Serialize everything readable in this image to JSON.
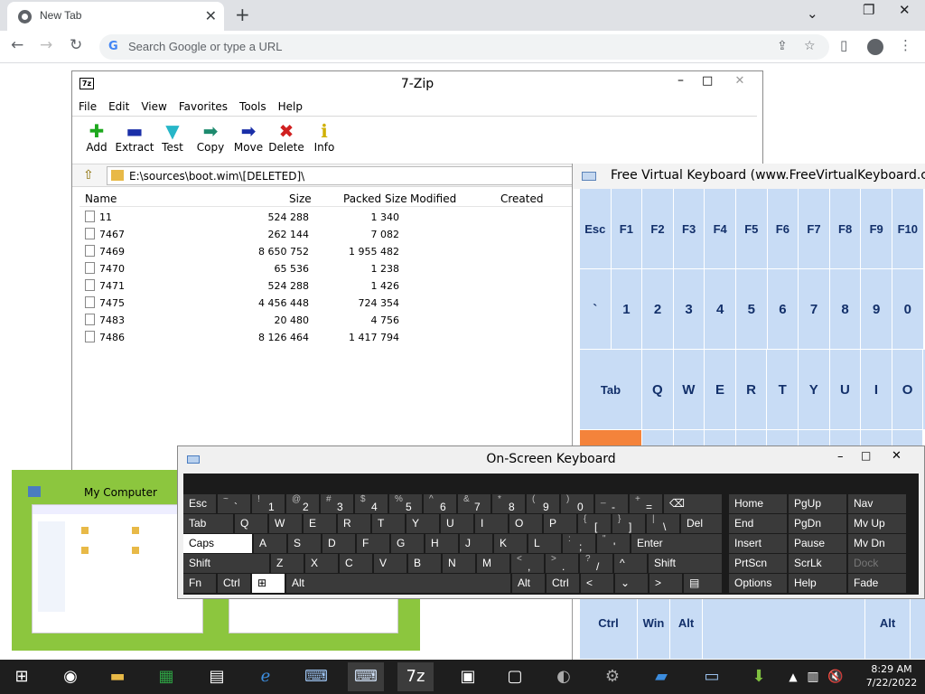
{
  "chrome": {
    "tab_title": "New Tab",
    "omnibox_placeholder": "Search Google or type a URL"
  },
  "sevenzip": {
    "title": "7-Zip",
    "menu": [
      "File",
      "Edit",
      "View",
      "Favorites",
      "Tools",
      "Help"
    ],
    "tools": [
      {
        "label": "Add",
        "icon": "plus-icon",
        "color": "#1ea81e"
      },
      {
        "label": "Extract",
        "icon": "minus-icon",
        "color": "#1a2fa8"
      },
      {
        "label": "Test",
        "icon": "check-icon",
        "color": "#27b6c8"
      },
      {
        "label": "Copy",
        "icon": "copy-arrow-icon",
        "color": "#1d8a6e"
      },
      {
        "label": "Move",
        "icon": "move-arrow-icon",
        "color": "#1a2fa8"
      },
      {
        "label": "Delete",
        "icon": "x-icon",
        "color": "#d02020"
      },
      {
        "label": "Info",
        "icon": "info-icon",
        "color": "#d0b000"
      }
    ],
    "path": "E:\\sources\\boot.wim\\[DELETED]\\",
    "columns": [
      "Name",
      "Size",
      "Packed Size",
      "Modified",
      "Created"
    ],
    "rows": [
      {
        "name": "11",
        "size": "524 288",
        "packed": "1 340"
      },
      {
        "name": "7467",
        "size": "262 144",
        "packed": "7 082"
      },
      {
        "name": "7469",
        "size": "8 650 752",
        "packed": "1 955 482"
      },
      {
        "name": "7470",
        "size": "65 536",
        "packed": "1 238"
      },
      {
        "name": "7471",
        "size": "524 288",
        "packed": "1 426"
      },
      {
        "name": "7475",
        "size": "4 456 448",
        "packed": "724 354"
      },
      {
        "name": "7483",
        "size": "20 480",
        "packed": "4 756"
      },
      {
        "name": "7486",
        "size": "8 126 464",
        "packed": "1 417 794"
      }
    ]
  },
  "fvk": {
    "title": "Free Virtual Keyboard (www.FreeVirtualKeyboard.com",
    "row1": [
      "Esc",
      "F1",
      "F2",
      "F3",
      "F4",
      "F5",
      "F6",
      "F7",
      "F8",
      "F9",
      "F10"
    ],
    "row2": [
      "`",
      "1",
      "2",
      "3",
      "4",
      "5",
      "6",
      "7",
      "8",
      "9",
      "0"
    ],
    "row3": [
      "Tab",
      "Q",
      "W",
      "E",
      "R",
      "T",
      "Y",
      "U",
      "I",
      "O"
    ],
    "bottom": [
      "Ctrl",
      "Win",
      "Alt",
      "Alt"
    ]
  },
  "osk": {
    "title": "On-Screen Keyboard",
    "nav": [
      [
        "Home",
        "PgUp",
        "Nav"
      ],
      [
        "End",
        "PgDn",
        "Mv Up"
      ],
      [
        "Insert",
        "Pause",
        "Mv Dn"
      ],
      [
        "PrtScn",
        "ScrLk",
        "Dock"
      ],
      [
        "Options",
        "Help",
        "Fade"
      ]
    ]
  },
  "mycomputer": {
    "title": "My Computer"
  },
  "taskbar": {
    "time": "8:29 AM",
    "date": "7/22/2022"
  }
}
